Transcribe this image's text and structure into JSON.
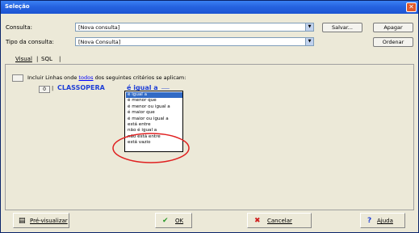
{
  "window": {
    "title": "Seleção"
  },
  "query": {
    "consulta_label": "Consulta:",
    "consulta_value": "[Nova consulta]",
    "tipo_label": "Tipo da consulta:",
    "tipo_value": "[Nova Consulta]",
    "salvar_label": "Salvar...",
    "apagar_label": "Apagar",
    "ordenar_label": "Ordenar"
  },
  "tabs": {
    "visual": "Visual",
    "sql": "SQL"
  },
  "rule": {
    "prefix": "Incluir Linhas onde",
    "link": "todos",
    "suffix": "dos seguintes critérios se aplicam:",
    "row_button": "0",
    "field": "CLASSOPERA",
    "operator": "é igual a"
  },
  "operator_options": [
    "é igual a",
    "é menor que",
    "é menor ou igual a",
    "é maior que",
    "é maior ou igual a",
    "está entre",
    "não é igual a",
    "não está entre",
    "está vazio"
  ],
  "selected_option": 0,
  "footer": {
    "preview_label": "Pré-visualizar",
    "ok_label": "OK",
    "cancel_label": "Cancelar",
    "help_label": "Ajuda"
  },
  "colors": {
    "title_bar": "#2663e0",
    "field_text": "#1f3fd6",
    "selection": "#316ac5",
    "annotation_circle": "#e02020"
  }
}
